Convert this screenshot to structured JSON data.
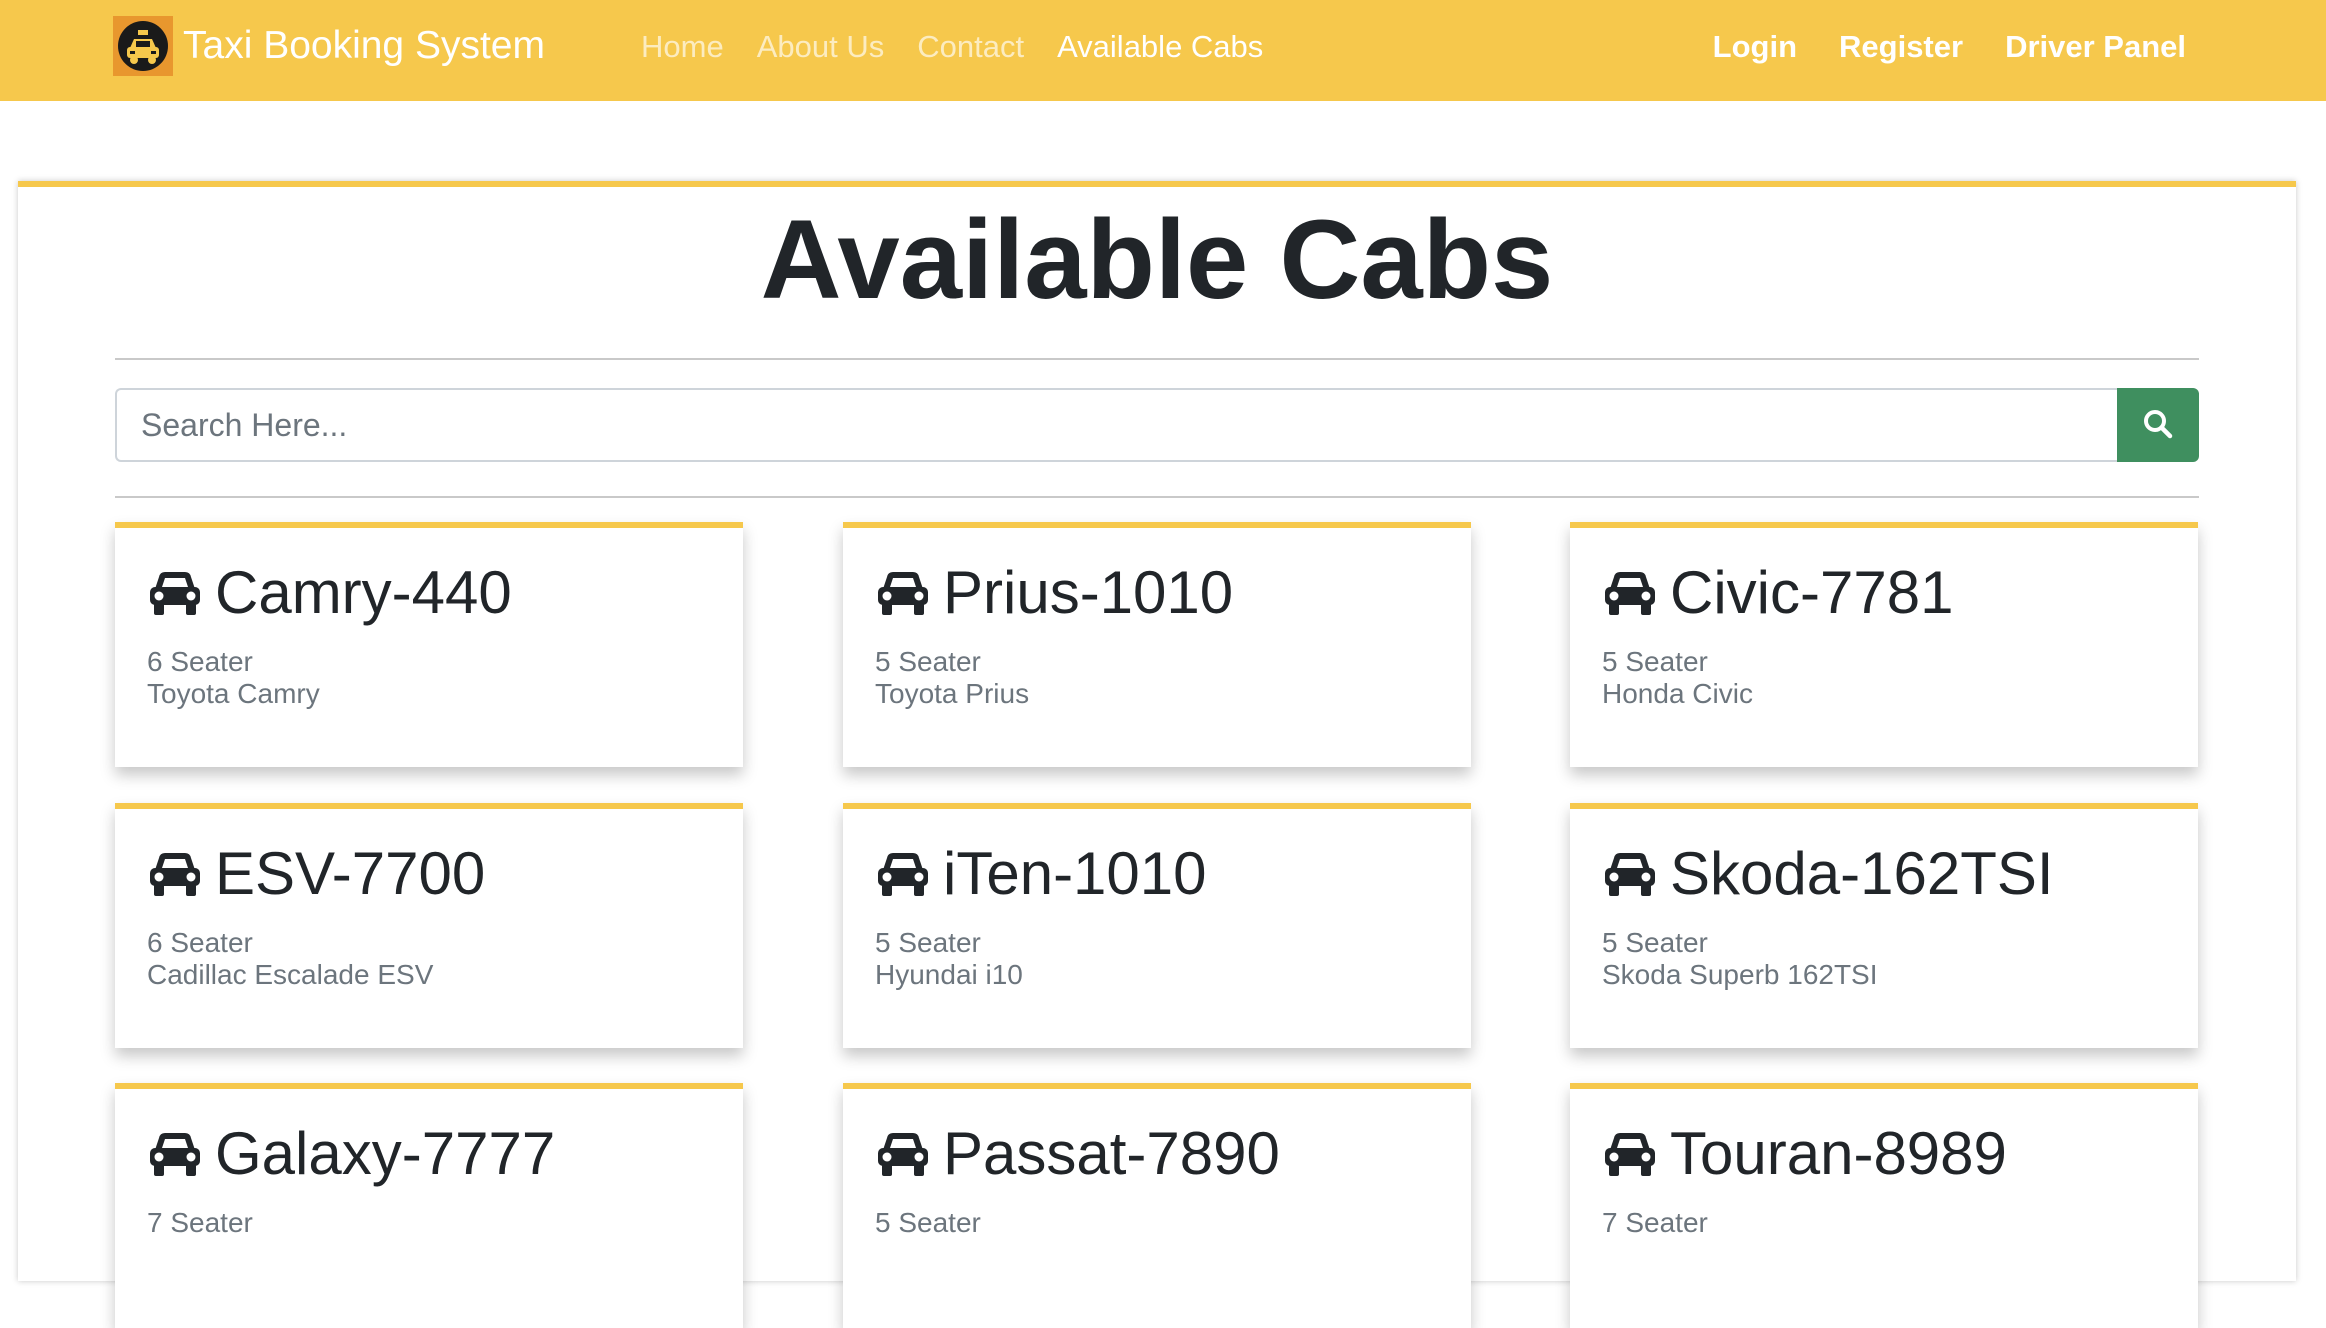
{
  "navbar": {
    "brand": "Taxi Booking System",
    "links": [
      {
        "label": "Home",
        "active": false
      },
      {
        "label": "About Us",
        "active": false
      },
      {
        "label": "Contact",
        "active": false
      },
      {
        "label": "Available Cabs",
        "active": true
      }
    ],
    "right_links": [
      "Login",
      "Register",
      "Driver Panel"
    ]
  },
  "main": {
    "title": "Available Cabs",
    "search": {
      "placeholder": "Search Here...",
      "value": ""
    },
    "cabs": [
      {
        "name": "Camry-440",
        "seats": "6 Seater",
        "model": "Toyota Camry"
      },
      {
        "name": "Prius-1010",
        "seats": "5 Seater",
        "model": "Toyota Prius"
      },
      {
        "name": "Civic-7781",
        "seats": "5 Seater",
        "model": "Honda Civic"
      },
      {
        "name": "ESV-7700",
        "seats": "6 Seater",
        "model": "Cadillac Escalade ESV"
      },
      {
        "name": "iTen-1010",
        "seats": "5 Seater",
        "model": "Hyundai i10"
      },
      {
        "name": "Skoda-162TSI",
        "seats": "5 Seater",
        "model": "Skoda Superb 162TSI"
      },
      {
        "name": "Galaxy-7777",
        "seats": "7 Seater",
        "model": ""
      },
      {
        "name": "Passat-7890",
        "seats": "5 Seater",
        "model": ""
      },
      {
        "name": "Touran-8989",
        "seats": "7 Seater",
        "model": ""
      }
    ]
  },
  "colors": {
    "navbar": "#f6c84c",
    "accent": "#f6c84c",
    "search_button": "#3f8f5f",
    "logo_bg": "#e8972e"
  },
  "icons": {
    "logo": "taxi-logo-icon",
    "search": "search-icon",
    "cab": "car-icon"
  }
}
